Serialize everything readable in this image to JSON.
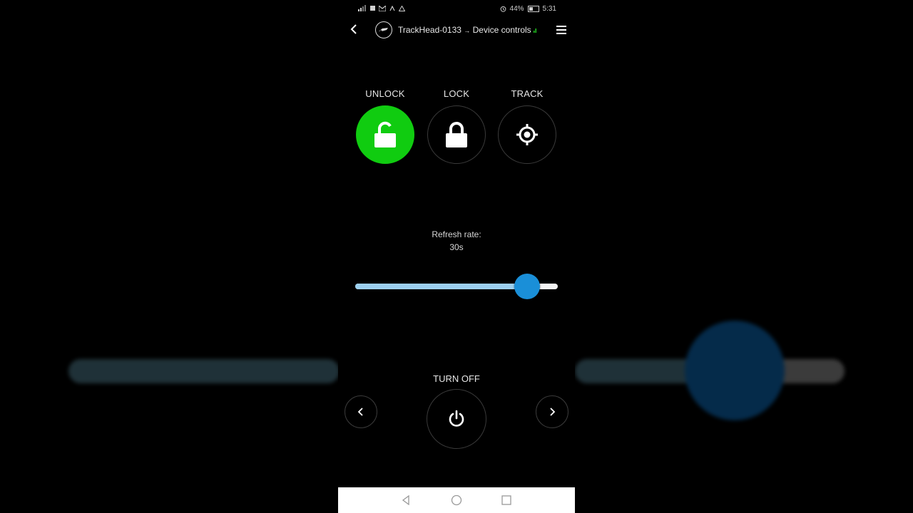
{
  "status_bar": {
    "battery": "44%",
    "time": "5:31"
  },
  "header": {
    "device_name": "TrackHead-0133",
    "separator": "→",
    "section": "Device controls"
  },
  "actions": [
    {
      "label": "UNLOCK",
      "icon": "unlock-icon",
      "active": true
    },
    {
      "label": "LOCK",
      "icon": "lock-icon",
      "active": false
    },
    {
      "label": "TRACK",
      "icon": "crosshair-icon",
      "active": false
    }
  ],
  "refresh": {
    "label": "Refresh rate:",
    "value": "30s",
    "slider_fraction": 0.85
  },
  "power": {
    "label": "TURN OFF",
    "icon": "power-icon"
  },
  "colors": {
    "accent_active": "#10cc10",
    "slider_thumb": "#1a8fd8",
    "slider_fill": "#9cd0f0"
  }
}
